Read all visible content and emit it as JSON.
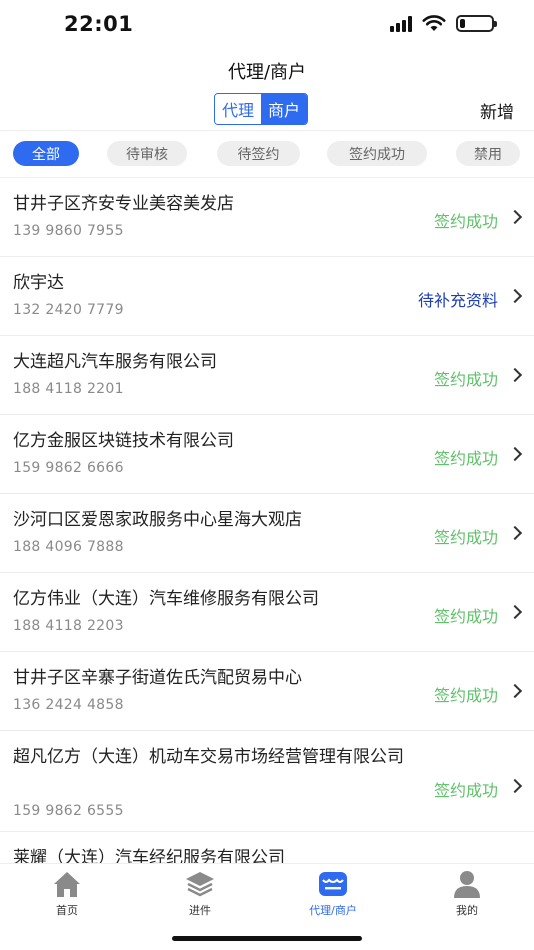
{
  "status_bar": {
    "time": "22:01",
    "battery_level": 0.18
  },
  "header": {
    "title": "代理/商户",
    "segments": [
      {
        "label": "代理",
        "active": false
      },
      {
        "label": "商户",
        "active": true
      }
    ],
    "add_label": "新增"
  },
  "filters": [
    {
      "label": "全部",
      "active": true
    },
    {
      "label": "待审核",
      "active": false
    },
    {
      "label": "待签约",
      "active": false
    },
    {
      "label": "签约成功",
      "active": false
    },
    {
      "label": "禁用",
      "active": false
    }
  ],
  "merchants": [
    {
      "name": "甘井子区齐安专业美容美发店",
      "phone": "139 9860 7955",
      "status": "签约成功"
    },
    {
      "name": "欣宇达",
      "phone": "132 2420 7779",
      "status": "待补充资料"
    },
    {
      "name": "大连超凡汽车服务有限公司",
      "phone": "188 4118 2201",
      "status": "签约成功"
    },
    {
      "name": "亿方金服区块链技术有限公司",
      "phone": "159 9862 6666",
      "status": "签约成功"
    },
    {
      "name": "沙河口区爱恩家政服务中心星海大观店",
      "phone": "188 4096 7888",
      "status": "签约成功"
    },
    {
      "name": "亿方伟业（大连）汽车维修服务有限公司",
      "phone": "188 4118 2203",
      "status": "签约成功"
    },
    {
      "name": "甘井子区辛寨子街道佐氏汽配贸易中心",
      "phone": "136 2424 4858",
      "status": "签约成功"
    },
    {
      "name": "超凡亿方（大连）机动车交易市场经营管理有限公司",
      "phone": "159 9862 6555",
      "status": "签约成功"
    },
    {
      "name": "莱耀（大连）汽车经纪服务有限公司",
      "phone": "",
      "status": ""
    }
  ],
  "tab_bar": [
    {
      "label": "首页",
      "icon": "home-icon",
      "active": false
    },
    {
      "label": "进件",
      "icon": "layers-icon",
      "active": false
    },
    {
      "label": "代理/商户",
      "icon": "store-icon",
      "active": true
    },
    {
      "label": "我的",
      "icon": "user-icon",
      "active": false
    }
  ],
  "colors": {
    "accent": "#2f6bf0",
    "success": "#5fc16a",
    "pending": "#1e3fb0"
  }
}
